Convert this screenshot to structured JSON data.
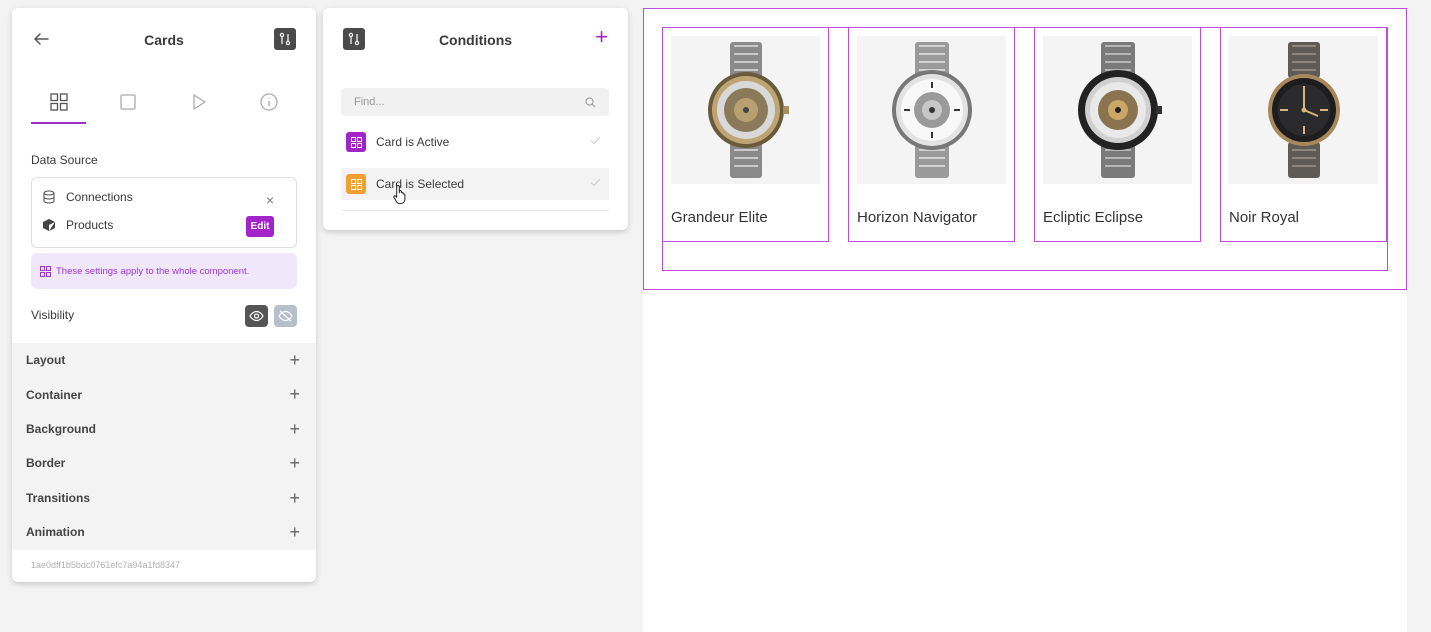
{
  "left_panel": {
    "title": "Cards",
    "tabs": [
      "grid-icon",
      "square-icon",
      "play-icon",
      "info-icon"
    ],
    "data_source": {
      "label": "Data Source",
      "connections": "Connections",
      "products": "Products",
      "edit": "Edit",
      "close": "×"
    },
    "note": "These settings apply to the whole component.",
    "visibility": "Visibility",
    "sections": [
      {
        "label": "Layout"
      },
      {
        "label": "Container"
      },
      {
        "label": "Background"
      },
      {
        "label": "Border"
      },
      {
        "label": "Transitions"
      },
      {
        "label": "Animation"
      }
    ],
    "plus": "+",
    "component_id": "1ae0dff1b5bdc0761efc7a94a1fd8347"
  },
  "conditions_panel": {
    "title": "Conditions",
    "add": "+",
    "search_placeholder": "Find...",
    "items": [
      {
        "label": "Card is Active",
        "color": "#a323c9"
      },
      {
        "label": "Card is Selected",
        "color": "#f0a030"
      }
    ]
  },
  "cards": [
    {
      "name": "Grandeur Elite"
    },
    {
      "name": "Horizon Navigator"
    },
    {
      "name": "Ecliptic Eclipse"
    },
    {
      "name": "Noir Royal"
    }
  ],
  "colors": {
    "accent": "#a323c9",
    "selection": "#c04cdc",
    "orange": "#f0a030"
  }
}
